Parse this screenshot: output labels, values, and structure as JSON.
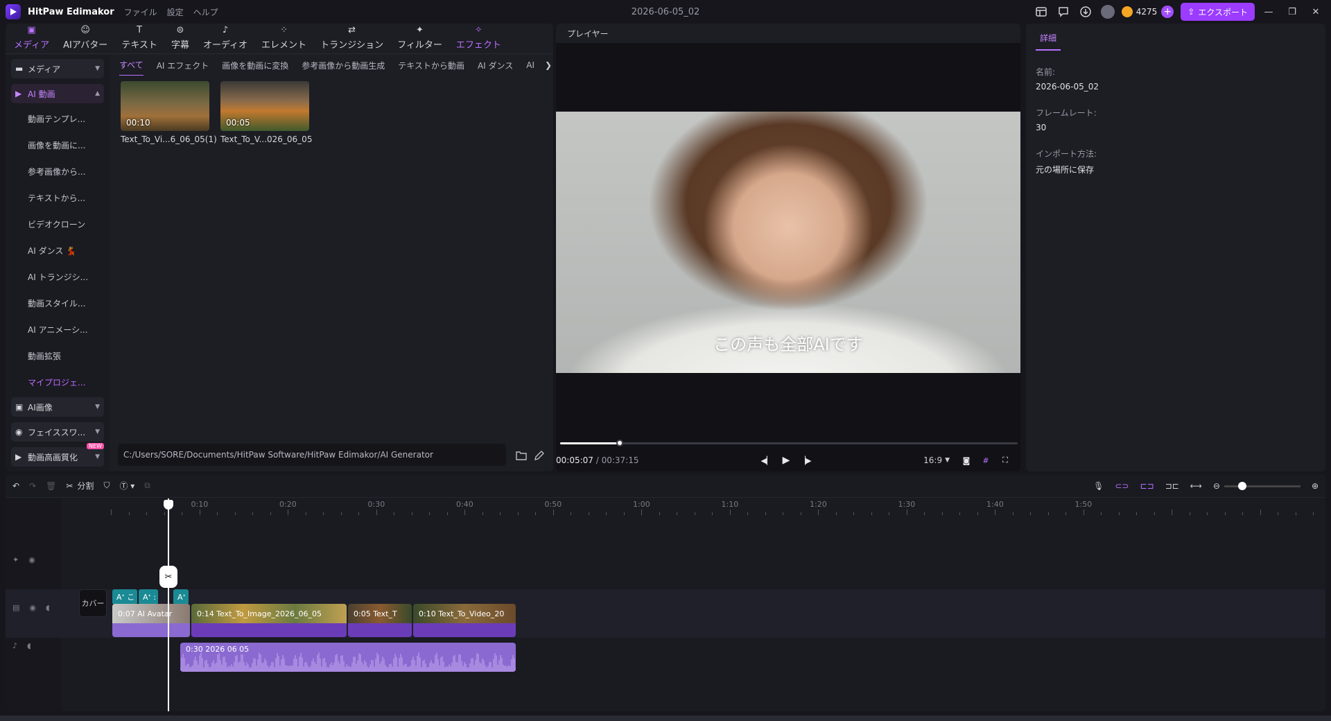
{
  "titlebar": {
    "app_name": "HitPaw Edimakor",
    "menu": [
      "ファイル",
      "設定",
      "ヘルプ"
    ],
    "doc_title": "2026-06-05_02",
    "credits": "4275",
    "export_label": "エクスポート"
  },
  "tool_tabs": [
    {
      "label": "メディア",
      "icon": "media-icon"
    },
    {
      "label": "AIアバター",
      "icon": "avatar-icon"
    },
    {
      "label": "テキスト",
      "icon": "text-icon"
    },
    {
      "label": "字幕",
      "icon": "subtitle-icon"
    },
    {
      "label": "オーディオ",
      "icon": "audio-icon"
    },
    {
      "label": "エレメント",
      "icon": "element-icon"
    },
    {
      "label": "トランジション",
      "icon": "transition-icon"
    },
    {
      "label": "フィルター",
      "icon": "filter-icon"
    },
    {
      "label": "エフェクト",
      "icon": "effect-icon"
    }
  ],
  "sidebar": {
    "media": "メディア",
    "ai_video": "AI 動画",
    "items": [
      "動画テンプレ...",
      "画像を動画に...",
      "参考画像から...",
      "テキストから...",
      "ビデオクローン",
      "AI ダンス 💃",
      "AI トランジシ...",
      "動画スタイル...",
      "AI アニメーシ...",
      "動画拡張",
      "マイプロジェ..."
    ],
    "ai_image": "AI画像",
    "face_swap": "フェイススワ...",
    "enhance": "動画高画質化",
    "new_badge": "NEW"
  },
  "filter_tabs": [
    "すべて",
    "AI エフェクト",
    "画像を動画に変換",
    "参考画像から動画生成",
    "テキストから動画",
    "AI ダンス",
    "AI"
  ],
  "thumbnails": [
    {
      "duration": "00:10",
      "name": "Text_To_Vi...6_06_05(1)"
    },
    {
      "duration": "00:05",
      "name": "Text_To_V...026_06_05"
    }
  ],
  "path": "C:/Users/SORE/Documents/HitPaw Software/HitPaw Edimakor/AI Generator",
  "player": {
    "header": "プレイヤー",
    "subtitle": "この声も全部AIです",
    "current_time": "00:05:07",
    "total_time": " / 00:37:15",
    "progress": 0.13,
    "ratio": "16:9"
  },
  "details": {
    "tab": "詳細",
    "name_label": "名前:",
    "name_value": "2026-06-05_02",
    "fps_label": "フレームレート:",
    "fps_value": "30",
    "import_label": "インポート方法:",
    "import_value": "元の場所に保存"
  },
  "timeline": {
    "split_label": "分割",
    "cover_label": "カバー",
    "ticks": [
      "0:10",
      "0:20",
      "0:30",
      "0:40",
      "0:50",
      "1:00",
      "1:10",
      "1:20",
      "1:30",
      "1:40",
      "1:50"
    ],
    "tts_chips": [
      "Aᐩ こ",
      "Aᐩ :",
      "Aᐩ"
    ],
    "clips": [
      "0:07 AI Avatar",
      "0:14 Text_To_Image_2026_06_05",
      "0:05 Text_T",
      "0:10 Text_To_Video_20"
    ],
    "audio_label": "0:30 2026 06 05"
  },
  "colors": {
    "accent": "#b872ff",
    "export": "#9b3cff",
    "tts": "#1a8a94",
    "audio": "#8a6ad0"
  }
}
